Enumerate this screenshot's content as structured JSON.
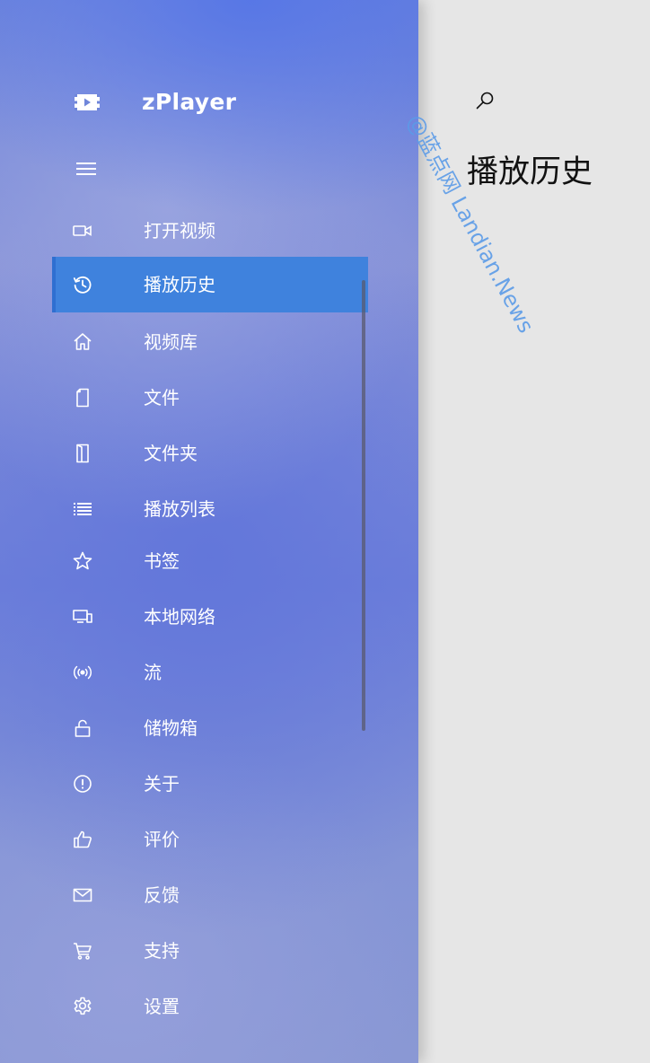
{
  "app": {
    "title": "zPlayer",
    "icon": "video-play-icon"
  },
  "sidebar": {
    "menu_icon": "hamburger-icon",
    "items": [
      {
        "label": "打开视频",
        "icon": "camera-icon",
        "selected": false
      },
      {
        "label": "播放历史",
        "icon": "history-icon",
        "selected": true
      },
      {
        "label": "视频库",
        "icon": "home-icon",
        "selected": false
      },
      {
        "label": "文件",
        "icon": "file-icon",
        "selected": false
      },
      {
        "label": "文件夹",
        "icon": "folder-icon",
        "selected": false
      },
      {
        "label": "播放列表",
        "icon": "list-icon",
        "selected": false
      },
      {
        "label": "书签",
        "icon": "star-icon",
        "selected": false
      },
      {
        "label": "本地网络",
        "icon": "network-icon",
        "selected": false
      },
      {
        "label": "流",
        "icon": "broadcast-icon",
        "selected": false
      },
      {
        "label": "储物箱",
        "icon": "lock-icon",
        "selected": false
      },
      {
        "label": "关于",
        "icon": "info-icon",
        "selected": false
      },
      {
        "label": "评价",
        "icon": "thumbs-up-icon",
        "selected": false
      },
      {
        "label": "反馈",
        "icon": "mail-icon",
        "selected": false
      },
      {
        "label": "支持",
        "icon": "cart-icon",
        "selected": false
      },
      {
        "label": "设置",
        "icon": "gear-icon",
        "selected": false
      }
    ]
  },
  "main": {
    "search_icon": "search-icon",
    "page_title": "播放历史"
  },
  "watermark": {
    "text": "@蓝点网 Landian.News"
  },
  "colors": {
    "selected_item": "#3f82dd",
    "main_background": "#e6e6e6",
    "watermark": "#5b9be8"
  }
}
